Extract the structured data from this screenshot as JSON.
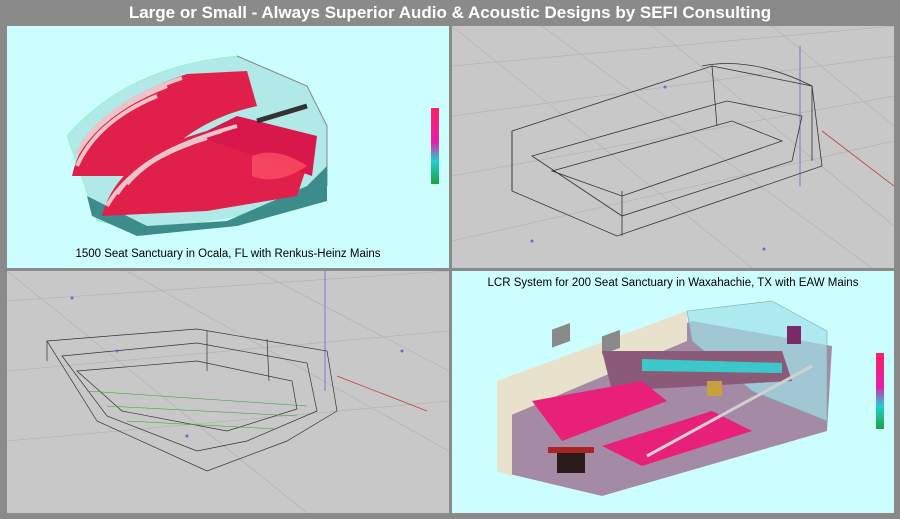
{
  "header": {
    "title": "Large or Small - Always Superior Audio & Acoustic Designs by SEFI Consulting"
  },
  "panels": [
    {
      "caption": "1500 Seat Sanctuary in Ocala, FL with Renkus-Heinz Mains"
    },
    {
      "caption": ""
    },
    {
      "caption": ""
    },
    {
      "caption": "LCR System for 200 Seat Sanctuary in Waxahachie, TX with EAW Mains"
    }
  ],
  "colors": {
    "frame": "#8a8a8a",
    "cyan_background": "#ccfeff",
    "grey_background": "#c8c8c8",
    "coverage_red": "#e0204a",
    "coverage_magenta": "#e8208a",
    "wall_teal": "#3c8c8c",
    "wireframe": "#333333"
  },
  "icons": [
    "color-scale-legend-icon"
  ]
}
